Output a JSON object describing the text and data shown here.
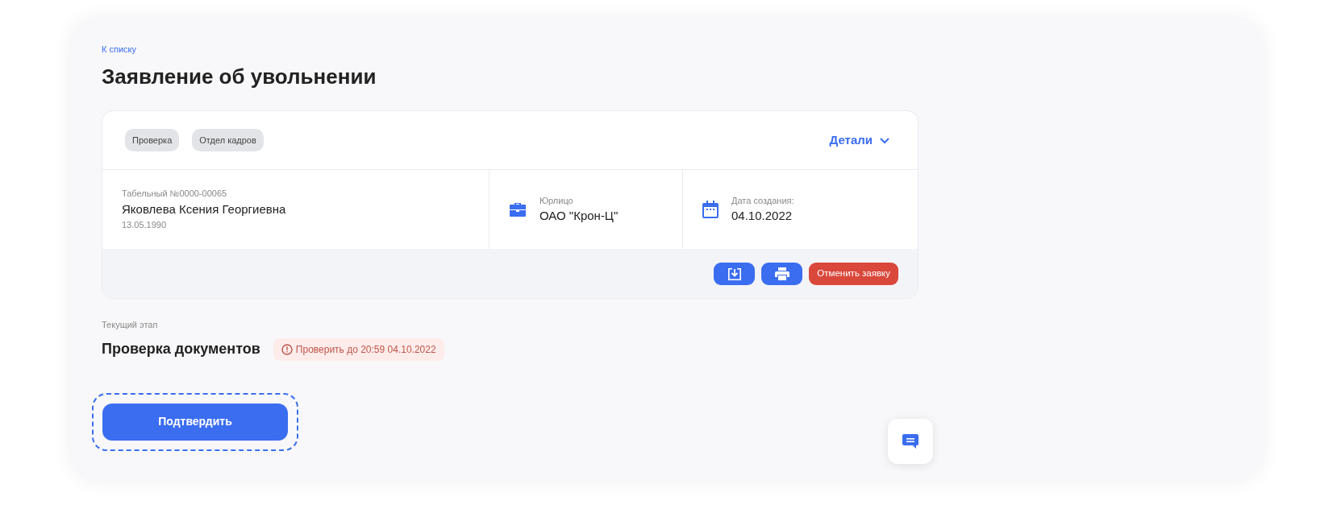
{
  "back_link": "К списку",
  "title": "Заявление об увольнении",
  "request_card": {
    "tags": [
      "Проверка",
      "Отдел кадров"
    ],
    "details_toggle": {
      "label": "Детали",
      "expanded": false
    },
    "employee": {
      "number": "Табельный №0000-00065",
      "name": "Яковлева Ксения Георгиевна",
      "birth_date": "13.05.1990"
    },
    "fields": [
      {
        "kind": "company",
        "label": "Юрлицо",
        "value": "ОАО \"Крон-Ц\""
      },
      {
        "kind": "date",
        "label": "Дата создания:",
        "value": "04.10.2022"
      }
    ],
    "actions": [
      {
        "kind": "download"
      },
      {
        "kind": "print"
      },
      {
        "kind": "cancel",
        "label": "Отменить заявку"
      }
    ]
  },
  "current_stage": {
    "caption": "Текущий этап",
    "name": "Проверка документов",
    "deadline": "Проверить до 20:59 04.10.2022"
  },
  "confirm_button": {
    "label": "Подтвердить",
    "focused": true
  }
}
